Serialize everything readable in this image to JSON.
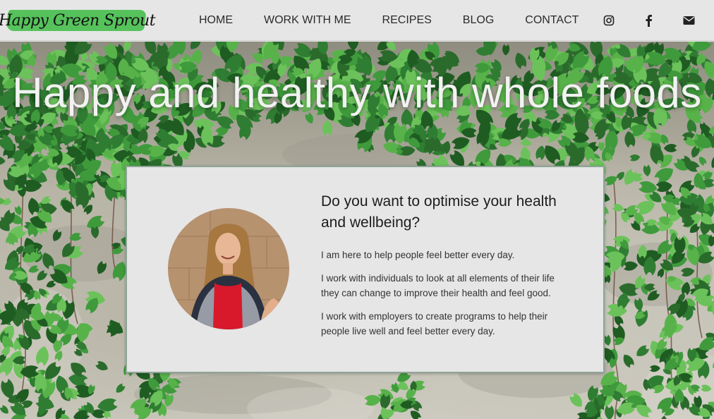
{
  "header": {
    "logo_text": "Happy Green Sprout",
    "nav": [
      {
        "label": "HOME"
      },
      {
        "label": "WORK WITH ME"
      },
      {
        "label": "RECIPES"
      },
      {
        "label": "BLOG"
      },
      {
        "label": "CONTACT"
      }
    ],
    "social_icons": [
      "instagram-icon",
      "facebook-icon",
      "email-icon"
    ]
  },
  "hero": {
    "title": "Happy and healthy with whole foods"
  },
  "card": {
    "heading": "Do you want to optimise your health and wellbeing?",
    "paragraphs": [
      "I am here to help people feel better every day.",
      "I work with individuals to look at all elements of their life they can change to improve their health and feel good.",
      "I work with employers to create programs to help their people live well and feel better every day."
    ]
  },
  "colors": {
    "header_bg": "#e6e6e6",
    "logo_swash": "#56c25c",
    "card_bg": "#e6e6e6",
    "card_border": "#8da597",
    "hero_title": "#f2f2f2"
  }
}
